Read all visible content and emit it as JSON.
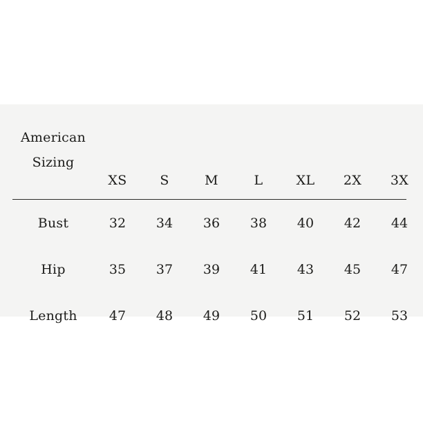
{
  "chart_data": {
    "type": "table",
    "title": "American Sizing",
    "title_lines": [
      "American",
      "Sizing"
    ],
    "categories": [
      "XS",
      "S",
      "M",
      "L",
      "XL",
      "2X",
      "3X"
    ],
    "row_labels": [
      "Bust",
      "Hip",
      "Length"
    ],
    "series": [
      {
        "name": "Bust",
        "values": [
          32,
          34,
          36,
          38,
          40,
          42,
          44
        ]
      },
      {
        "name": "Hip",
        "values": [
          35,
          37,
          39,
          41,
          43,
          45,
          47
        ]
      },
      {
        "name": "Length",
        "values": [
          47,
          48,
          49,
          50,
          51,
          52,
          53
        ]
      }
    ],
    "xlabel": "",
    "ylabel": "",
    "grid": false,
    "legend": "none"
  },
  "table": {
    "title_line_1": "American",
    "title_line_2": "Sizing",
    "headers": [
      "XS",
      "S",
      "M",
      "L",
      "XL",
      "2X",
      "3X"
    ],
    "rows": [
      {
        "label": "Bust",
        "values": [
          "32",
          "34",
          "36",
          "38",
          "40",
          "42",
          "44"
        ]
      },
      {
        "label": "Hip",
        "values": [
          "35",
          "37",
          "39",
          "41",
          "43",
          "45",
          "47"
        ]
      },
      {
        "label": "Length",
        "values": [
          "47",
          "48",
          "49",
          "50",
          "51",
          "52",
          "53"
        ]
      }
    ]
  },
  "colors": {
    "page_background": "#ffffff",
    "table_background": "#f4f4f3",
    "text": "#1c1c1a",
    "rule": "#2b2b29"
  }
}
